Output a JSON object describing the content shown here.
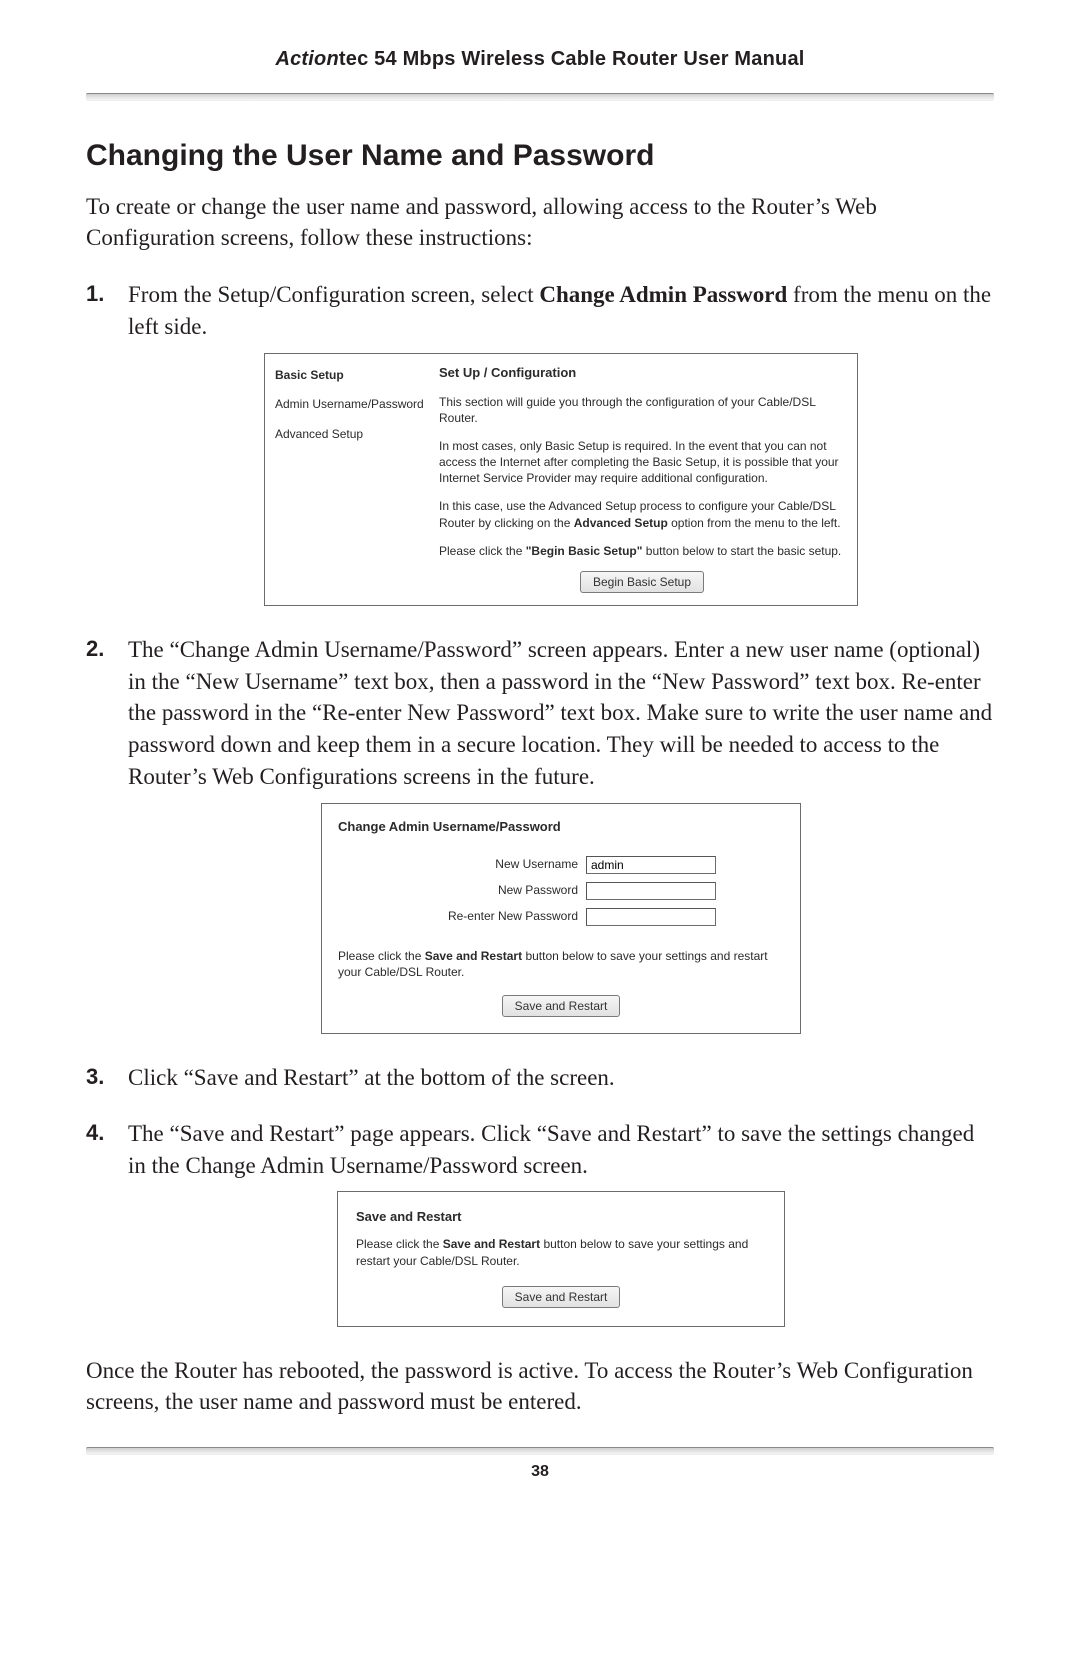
{
  "header": {
    "brand_bold_italic": "Action",
    "brand_bold": "tec",
    "rest": " 54 Mbps Wireless Cable Router User Manual"
  },
  "page_number": "38",
  "section_title": "Changing the User Name and Password",
  "intro": "To create or change the user name and password, allowing access to the Router’s Web Configuration screens, follow these instructions:",
  "steps": {
    "s1": {
      "pre": "From the Setup/Configuration screen, select ",
      "bold": "Change Admin Password",
      "post": " from the menu on the left side."
    },
    "s2": "The “Change Admin Username/Password” screen appears. Enter a new user name (optional) in the “New Username” text box, then a password in the “New Password” text box. Re-enter the password in the “Re-enter New Password” text box. Make sure to write the user name and password down and keep them in a secure location. They will be needed to access to the Router’s Web Configurations screens in the future.",
    "s3": "Click “Save and Restart” at the bottom of the screen.",
    "s4": "The “Save and Restart” page appears. Click “Save and Restart” to save the settings changed in the Change Admin Username/Password screen."
  },
  "closing": "Once the Router has rebooted, the password is active. To access the Router’s Web Configuration screens, the user name and password must be entered.",
  "shot1": {
    "sidebar": {
      "basic_setup": "Basic Setup",
      "admin_user_pass": "Admin Username/Password",
      "advanced_setup": "Advanced Setup"
    },
    "title": "Set Up / Configuration",
    "p1": "This section will guide you through the configuration of your Cable/DSL Router.",
    "p2": "In most cases, only Basic Setup is required. In the event that you can not access the Internet after completing the Basic Setup, it is possible that your Internet Service Provider may require additional configuration.",
    "p3_pre": "In this case, use the Advanced Setup process to configure your Cable/DSL Router by clicking on the ",
    "p3_bold": "Advanced Setup",
    "p3_post": " option from the menu to the left.",
    "p4_pre": "Please click the ",
    "p4_bold": "\"Begin Basic Setup\"",
    "p4_post": " button below to start the basic setup.",
    "button": "Begin Basic Setup"
  },
  "shot2": {
    "title": "Change Admin Username/Password",
    "labels": {
      "new_username": "New Username",
      "new_password": "New Password",
      "reenter_password": "Re-enter New Password"
    },
    "values": {
      "new_username": "admin",
      "new_password": "",
      "reenter_password": ""
    },
    "note_pre": "Please click the ",
    "note_bold": "Save and Restart",
    "note_post": " button below to save your settings and restart your Cable/DSL Router.",
    "button": "Save and Restart"
  },
  "shot3": {
    "title": "Save and Restart",
    "note_pre": "Please click the ",
    "note_bold": "Save and Restart",
    "note_post": " button below to save your settings and restart your Cable/DSL Router.",
    "button": "Save and Restart"
  }
}
